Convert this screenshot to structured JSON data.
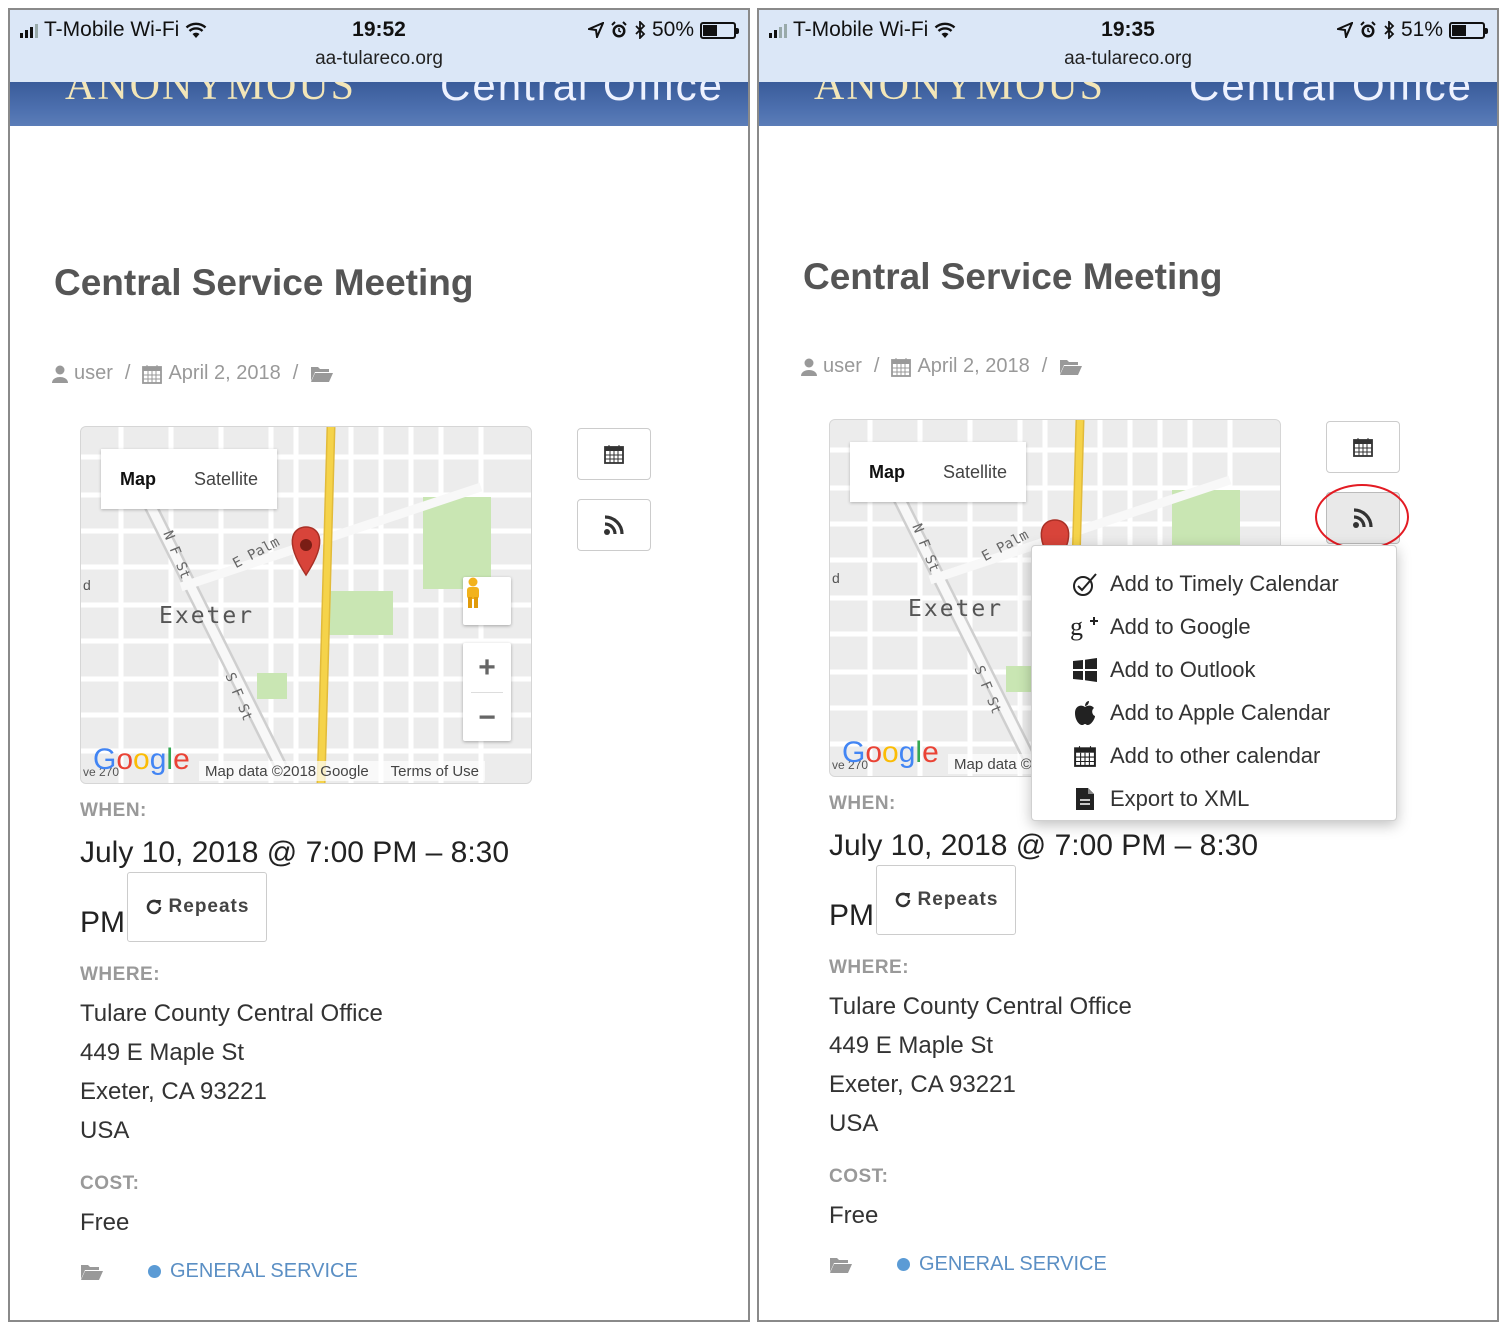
{
  "screens": [
    {
      "status": {
        "carrier": "T-Mobile Wi-Fi",
        "time": "19:52",
        "battery": "50%",
        "battery_level": 0.5,
        "url": "aa-tulareco.org"
      },
      "banner": {
        "left_text": "ANONYMOUS",
        "right_text": "Central Office"
      },
      "event": {
        "title": "Central Service Meeting",
        "author": "user",
        "date": "April 2, 2018",
        "when_label": "WHEN:",
        "when_line1": "July 10, 2018 @ 7:00 PM – 8:30",
        "when_line2": "PM",
        "repeats_label": "Repeats",
        "where_label": "WHERE:",
        "address": [
          "Tulare County Central Office",
          "449 E Maple St",
          "Exeter, CA 93221",
          "USA"
        ],
        "cost_label": "COST:",
        "cost": "Free",
        "category": "GENERAL SERVICE"
      },
      "map": {
        "tab_map": "Map",
        "tab_satellite": "Satellite",
        "city": "Exeter",
        "street_palm": "E Palm",
        "street_nf": "N F St",
        "street_sf": "S F St",
        "edge_left": "d",
        "edge_bottom": "ve 270",
        "attribution": "Map data ©2018 Google",
        "terms": "Terms of Use",
        "zoom_in": "+",
        "zoom_out": "−"
      }
    },
    {
      "status": {
        "carrier": "T-Mobile Wi-Fi",
        "time": "19:35",
        "battery": "51%",
        "battery_level": 0.51,
        "url": "aa-tulareco.org"
      },
      "banner": {
        "left_text": "ANONYMOUS",
        "right_text": "Central Office"
      },
      "event": {
        "title": "Central Service Meeting",
        "author": "user",
        "date": "April 2, 2018",
        "when_label": "WHEN:",
        "when_line1": "July 10, 2018 @ 7:00 PM – 8:30",
        "when_line2": "PM",
        "repeats_label": "Repeats",
        "where_label": "WHERE:",
        "address": [
          "Tulare County Central Office",
          "449 E Maple St",
          "Exeter, CA 93221",
          "USA"
        ],
        "cost_label": "COST:",
        "cost": "Free",
        "category": "GENERAL SERVICE"
      },
      "map": {
        "tab_map": "Map",
        "tab_satellite": "Satellite",
        "city": "Exeter",
        "street_palm": "E Palm",
        "street_nf": "N F St",
        "street_sf": "S F St",
        "edge_left": "d",
        "edge_bottom": "ve 270",
        "attribution": "Map data ©"
      },
      "export_menu": [
        {
          "label": "Add to Timely Calendar",
          "icon": "timely-icon"
        },
        {
          "label": "Add to Google",
          "icon": "google-plus-icon"
        },
        {
          "label": "Add to Outlook",
          "icon": "windows-icon"
        },
        {
          "label": "Add to Apple Calendar",
          "icon": "apple-icon"
        },
        {
          "label": "Add to other calendar",
          "icon": "calendar-icon"
        },
        {
          "label": "Export to XML",
          "icon": "file-icon"
        }
      ]
    }
  ],
  "colors": {
    "banner": "#4c6fae",
    "statusbar": "#dbe7f7",
    "accent_link": "#5b8fc4",
    "highlight_ring": "#e31b23",
    "map_marker": "#d8443a",
    "map_road_yellow": "#f5d34a",
    "map_park": "#c9e6b3"
  }
}
